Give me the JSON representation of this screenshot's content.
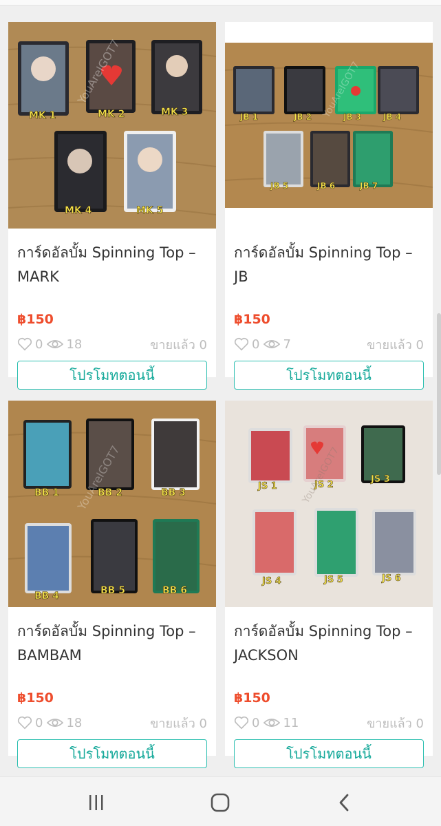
{
  "products": [
    {
      "title": "การ์ดอัลบั้ม Spinning Top – MARK",
      "price": "฿150",
      "likes": "0",
      "views": "18",
      "sold": "ขายแล้ว 0",
      "promo_label": "โปรโมทตอนนี้",
      "card_labels": [
        "MK 1",
        "MK 2",
        "MK 3",
        "MK 4",
        "MK 5"
      ],
      "watermark": "YouAreIGOT7",
      "background": "#b08a55"
    },
    {
      "title": "การ์ดอัลบั้ม Spinning Top – JB",
      "price": "฿150",
      "likes": "0",
      "views": "7",
      "sold": "ขายแล้ว 0",
      "promo_label": "โปรโมทตอนนี้",
      "card_labels": [
        "JB 1",
        "JB 2",
        "JB 3",
        "JB 4",
        "JB 5",
        "JB 6",
        "JB 7"
      ],
      "watermark": "YouAreIGOT7",
      "background": "#b3884f"
    },
    {
      "title": "การ์ดอัลบั้ม Spinning Top – BAMBAM",
      "price": "฿150",
      "likes": "0",
      "views": "18",
      "sold": "ขายแล้ว 0",
      "promo_label": "โปรโมทตอนนี้",
      "card_labels": [
        "BB 1",
        "BB 2",
        "BB 3",
        "BB 4",
        "BB 5",
        "BB 6"
      ],
      "watermark": "YouAreIGOT7",
      "background": "#b0864e"
    },
    {
      "title": "การ์ดอัลบั้ม Spinning Top – JACKSON",
      "price": "฿150",
      "likes": "0",
      "views": "11",
      "sold": "ขายแล้ว 0",
      "promo_label": "โปรโมทตอนนี้",
      "card_labels": [
        "JS 1",
        "JS 2",
        "JS 3",
        "JS 4",
        "JS 5",
        "JS 6"
      ],
      "watermark": "YouAreIGOT7",
      "background": "#e9e3dc"
    }
  ],
  "colors": {
    "price": "#ee4d2d",
    "promo_border": "#2cbfb0",
    "label_yellow": "#f4e24a"
  },
  "nav": {
    "recent_icon": "recent-apps-icon",
    "home_icon": "home-icon",
    "back_icon": "back-icon"
  }
}
